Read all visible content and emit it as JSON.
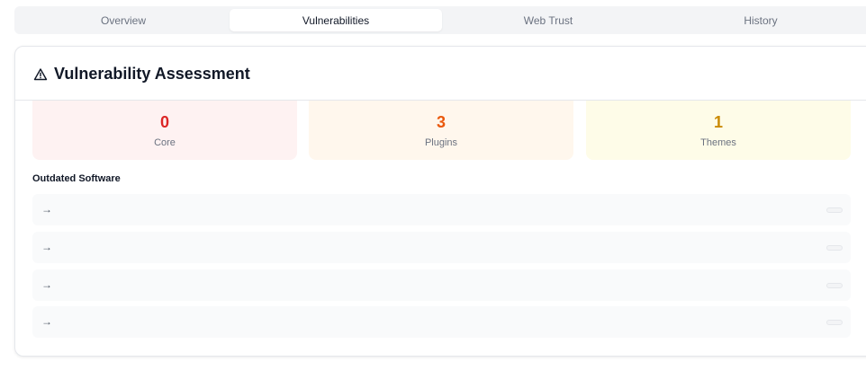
{
  "tabs": [
    {
      "label": "Overview",
      "active": false
    },
    {
      "label": "Vulnerabilities",
      "active": true
    },
    {
      "label": "Web Trust",
      "active": false
    },
    {
      "label": "History",
      "active": false
    }
  ],
  "card": {
    "icon": "warning-triangle-icon",
    "title": "Vulnerability Assessment"
  },
  "stats": [
    {
      "value": "0",
      "label": "Core",
      "color": "#dc2626",
      "bg": "#fef2f2"
    },
    {
      "value": "3",
      "label": "Plugins",
      "color": "#ea580c",
      "bg": "#fff7ed"
    },
    {
      "value": "1",
      "label": "Themes",
      "color": "#ca8a04",
      "bg": "#fefce8"
    }
  ],
  "outdated": {
    "heading": "Outdated Software",
    "items": [
      {
        "arrow": "→"
      },
      {
        "arrow": "→"
      },
      {
        "arrow": "→"
      },
      {
        "arrow": "→"
      }
    ]
  }
}
